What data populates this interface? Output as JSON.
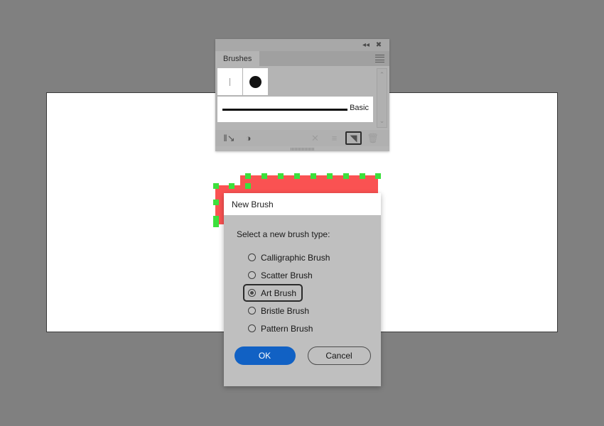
{
  "app": {
    "background_color": "#808080",
    "canvas_color": "#ffffff"
  },
  "artwork": {
    "fill_color": "#fa5252",
    "anchor_color": "#3ce03c",
    "anchor_count": 19,
    "selected": true
  },
  "brushes_panel": {
    "tab_label": "Brushes",
    "titlebar": {
      "collapse_icon": "double-chevron-left-icon",
      "collapse_glyph": "◂◂",
      "close_icon": "close-icon",
      "close_glyph": "✖"
    },
    "menu_icon": "panel-menu-icon",
    "scrollbar": {
      "up_glyph": "⌃",
      "down_glyph": "⌄"
    },
    "swatches": [
      {
        "name": "calligraphic-swatch",
        "type": "line"
      },
      {
        "name": "dot-swatch",
        "type": "dot"
      }
    ],
    "stroke_item": {
      "label": "Basic",
      "selected": true
    },
    "footer_buttons": [
      {
        "name": "brush-libraries-menu",
        "glyph": "‖↘",
        "selected": false,
        "disabled": false
      },
      {
        "name": "libraries-panel",
        "glyph": "◑",
        "selected": false,
        "disabled": false
      },
      {
        "name": "remove-brush-link",
        "glyph": "✕",
        "selected": false,
        "disabled": true
      },
      {
        "name": "options-of-selected-object",
        "glyph": "≡",
        "selected": false,
        "disabled": true
      },
      {
        "name": "new-brush",
        "glyph": "◥",
        "selected": true,
        "disabled": false
      },
      {
        "name": "delete-brush",
        "glyph": "🗑",
        "selected": false,
        "disabled": true
      }
    ]
  },
  "new_brush_dialog": {
    "title": "New Brush",
    "prompt": "Select a new brush type:",
    "options": [
      {
        "label": "Calligraphic Brush",
        "selected": false
      },
      {
        "label": "Scatter Brush",
        "selected": false
      },
      {
        "label": "Art Brush",
        "selected": true
      },
      {
        "label": "Bristle Brush",
        "selected": false
      },
      {
        "label": "Pattern Brush",
        "selected": false
      }
    ],
    "ok_label": "OK",
    "cancel_label": "Cancel",
    "ok_color": "#1161c4"
  }
}
